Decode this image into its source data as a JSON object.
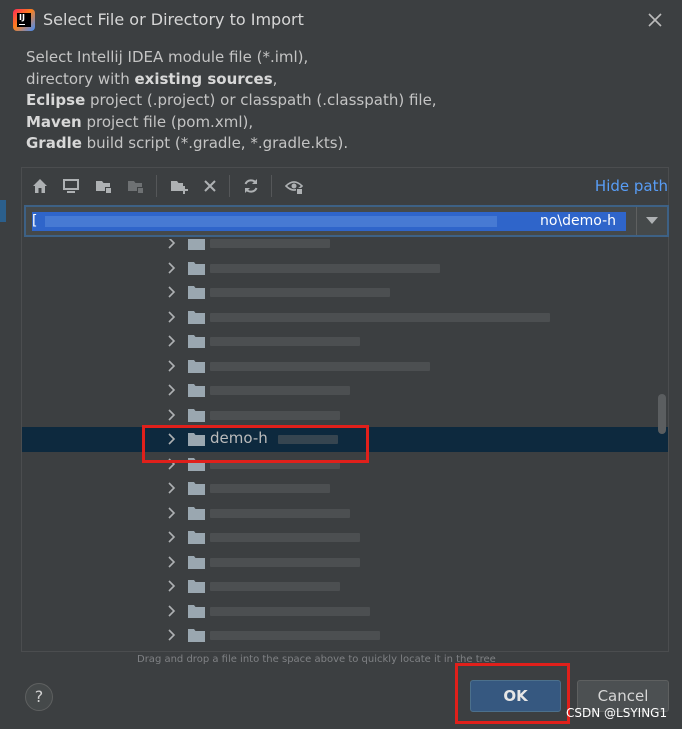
{
  "window": {
    "title": "Select File or Directory to Import",
    "icon": "intellij-idea-icon"
  },
  "description": {
    "line1_text": "Select Intellij IDEA module file (*.iml),",
    "line2_pre": "directory with ",
    "line2_bold": "existing sources",
    "line2_post": ",",
    "line3_bold": "Eclipse",
    "line3_post": " project (.project) or classpath (.classpath) file,",
    "line4_bold": "Maven",
    "line4_post": " project file (pom.xml),",
    "line5_bold": "Gradle",
    "line5_post": " build script (*.gradle, *.gradle.kts)."
  },
  "toolbar": {
    "icons": [
      "home-icon",
      "desktop-icon",
      "project-folder-icon",
      "module-folder-icon",
      "new-folder-icon",
      "delete-icon",
      "refresh-icon",
      "show-hidden-icon"
    ],
    "hide_path_label": "Hide path"
  },
  "path": {
    "visible_prefix": "[",
    "visible_suffix": "no\\demo-h"
  },
  "tree": {
    "selected_label": "demo-h",
    "row_count": 17,
    "selected_index": 8
  },
  "hint": "Drag and drop a file into the space above to quickly locate it in the tree",
  "buttons": {
    "help_label": "?",
    "ok_label": "OK",
    "cancel_label": "Cancel"
  },
  "watermark": "CSDN @LSYING1",
  "colors": {
    "background": "#3c3f41",
    "accent_link": "#589df6",
    "ok_button": "#365880",
    "selection": "#0d293e",
    "highlight_box": "#e0201b"
  }
}
